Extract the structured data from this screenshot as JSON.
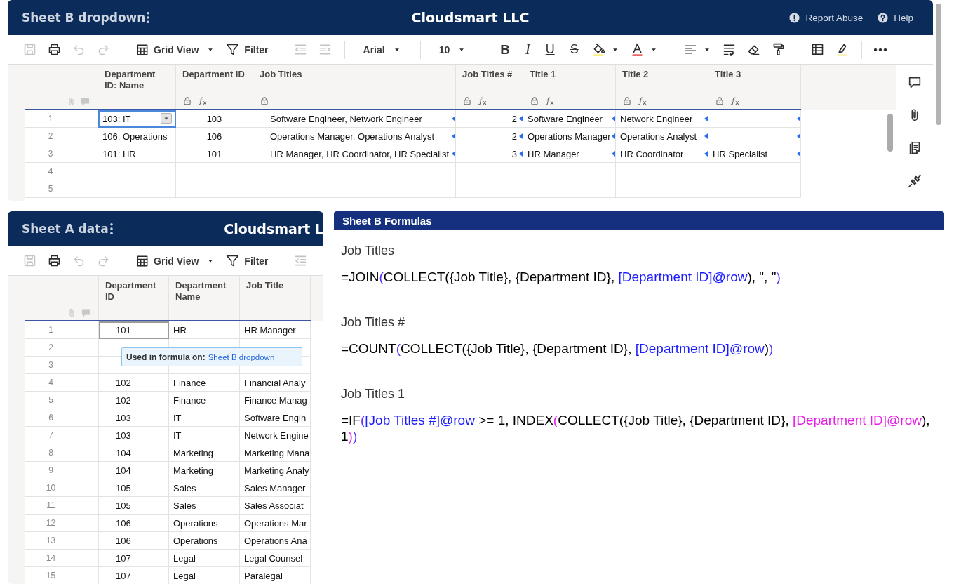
{
  "top_sheet": {
    "title": "Sheet B dropdown",
    "brand": "Cloudsmart LLC",
    "links": [
      {
        "kind": "report",
        "label": "Report Abuse"
      },
      {
        "kind": "help",
        "label": "Help"
      }
    ],
    "toolbar": [
      {
        "kind": "save",
        "disabled": true
      },
      {
        "kind": "print",
        "disabled": false
      },
      {
        "kind": "undo",
        "disabled": true
      },
      {
        "kind": "redo",
        "disabled": true
      },
      {
        "kind": "sep"
      },
      {
        "kind": "view",
        "label": "Grid View",
        "disabled": false
      },
      {
        "kind": "filter",
        "label": "Filter",
        "disabled": false
      },
      {
        "kind": "sep"
      },
      {
        "kind": "outdent",
        "disabled": true
      },
      {
        "kind": "indent",
        "disabled": true
      },
      {
        "kind": "sep"
      },
      {
        "kind": "font",
        "label": "Arial",
        "disabled": false
      },
      {
        "kind": "sep"
      },
      {
        "kind": "size",
        "label": "10",
        "disabled": false
      },
      {
        "kind": "sep"
      },
      {
        "kind": "bold",
        "label": "B",
        "disabled": false
      },
      {
        "kind": "italic",
        "label": "I",
        "disabled": false
      },
      {
        "kind": "underline",
        "label": "U",
        "disabled": false
      },
      {
        "kind": "strike",
        "label": "S",
        "disabled": false
      },
      {
        "kind": "fill",
        "disabled": false
      },
      {
        "kind": "textcolor",
        "disabled": false
      },
      {
        "kind": "sep"
      },
      {
        "kind": "align",
        "disabled": false
      },
      {
        "kind": "wrap",
        "disabled": false
      },
      {
        "kind": "eraser",
        "disabled": false
      },
      {
        "kind": "painter",
        "disabled": false
      },
      {
        "kind": "sep"
      },
      {
        "kind": "table",
        "disabled": false
      },
      {
        "kind": "highlight",
        "disabled": false
      },
      {
        "kind": "sep"
      },
      {
        "kind": "more",
        "disabled": false
      }
    ],
    "columns": [
      {
        "label": "Department ID: Name",
        "locked": false,
        "formula": false,
        "linked": false
      },
      {
        "label": "Department ID",
        "locked": true,
        "formula": true,
        "linked": false
      },
      {
        "label": "Job Titles",
        "locked": true,
        "formula": false,
        "linked": true
      },
      {
        "label": "Job Titles #",
        "locked": true,
        "formula": true,
        "linked": true
      },
      {
        "label": "Title 1",
        "locked": true,
        "formula": true,
        "linked": true
      },
      {
        "label": "Title 2",
        "locked": true,
        "formula": true,
        "linked": true
      },
      {
        "label": "Title 3",
        "locked": true,
        "formula": true,
        "linked": true
      }
    ],
    "rows": [
      {
        "number": "1",
        "cells": [
          {
            "text": "103: IT",
            "selected": true
          },
          {
            "text": "103",
            "selected": false
          },
          {
            "text": "Software Engineer, Network Engineer",
            "selected": false
          },
          {
            "text": "2",
            "selected": false
          },
          {
            "text": "Software Engineer",
            "selected": false
          },
          {
            "text": "Network Engineer",
            "selected": false
          },
          {
            "selected": false
          }
        ]
      },
      {
        "number": "2",
        "cells": [
          {
            "text": "106: Operations",
            "selected": false
          },
          {
            "text": "106",
            "selected": false
          },
          {
            "text": "Operations Manager, Operations Analyst",
            "selected": false
          },
          {
            "text": "2",
            "selected": false
          },
          {
            "text": "Operations Manager",
            "selected": false
          },
          {
            "text": "Operations Analyst",
            "selected": false
          },
          {
            "selected": false
          }
        ]
      },
      {
        "number": "3",
        "cells": [
          {
            "text": "101: HR",
            "selected": false
          },
          {
            "text": "101",
            "selected": false
          },
          {
            "text": "HR Manager, HR Coordinator, HR Specialist",
            "selected": false
          },
          {
            "text": "3",
            "selected": false
          },
          {
            "text": "HR Manager",
            "selected": false
          },
          {
            "text": "HR Coordinator",
            "selected": false
          },
          {
            "text": "HR Specialist",
            "selected": false
          }
        ]
      },
      {
        "number": "4",
        "cells": []
      },
      {
        "number": "5",
        "cells": []
      }
    ],
    "side_tools": [
      {
        "kind": "comments"
      },
      {
        "kind": "attachments"
      },
      {
        "kind": "summary"
      },
      {
        "kind": "connections"
      }
    ]
  },
  "bottom_sheet": {
    "title": "Sheet A data",
    "brand": "Cloudsmart L",
    "toolbar": [
      {
        "kind": "save",
        "disabled": true
      },
      {
        "kind": "print",
        "disabled": false
      },
      {
        "kind": "undo",
        "disabled": true
      },
      {
        "kind": "redo",
        "disabled": true
      },
      {
        "kind": "sep"
      },
      {
        "kind": "view",
        "label": "Grid View",
        "disabled": false
      },
      {
        "kind": "filter",
        "label": "Filter",
        "disabled": false
      },
      {
        "kind": "sep"
      },
      {
        "kind": "outdent",
        "disabled": true
      }
    ],
    "columns": [
      {
        "label": "Department ID"
      },
      {
        "label": "Department Name"
      },
      {
        "label": "Job Title"
      }
    ],
    "rows": [
      {
        "number": "1",
        "cells": [
          {
            "text": "101",
            "selected": true
          },
          {
            "text": "HR",
            "selected": false
          },
          {
            "text": "HR Manager",
            "selected": false
          }
        ]
      },
      {
        "number": "2",
        "cells": [
          {
            "selected": false
          },
          {
            "selected": false
          },
          {
            "selected": false
          }
        ]
      },
      {
        "number": "3",
        "cells": [
          {
            "selected": false
          },
          {
            "selected": false
          },
          {
            "selected": false
          }
        ]
      },
      {
        "number": "4",
        "cells": [
          {
            "text": "102",
            "selected": false
          },
          {
            "text": "Finance",
            "selected": false
          },
          {
            "text": "Financial Analy",
            "selected": false
          }
        ]
      },
      {
        "number": "5",
        "cells": [
          {
            "text": "102",
            "selected": false
          },
          {
            "text": "Finance",
            "selected": false
          },
          {
            "text": "Finance Manag",
            "selected": false
          }
        ]
      },
      {
        "number": "6",
        "cells": [
          {
            "text": "103",
            "selected": false
          },
          {
            "text": "IT",
            "selected": false
          },
          {
            "text": "Software Engin",
            "selected": false
          }
        ]
      },
      {
        "number": "7",
        "cells": [
          {
            "text": "103",
            "selected": false
          },
          {
            "text": "IT",
            "selected": false
          },
          {
            "text": "Network Engine",
            "selected": false
          }
        ]
      },
      {
        "number": "8",
        "cells": [
          {
            "text": "104",
            "selected": false
          },
          {
            "text": "Marketing",
            "selected": false
          },
          {
            "text": "Marketing Mana",
            "selected": false
          }
        ]
      },
      {
        "number": "9",
        "cells": [
          {
            "text": "104",
            "selected": false
          },
          {
            "text": "Marketing",
            "selected": false
          },
          {
            "text": "Marketing Analy",
            "selected": false
          }
        ]
      },
      {
        "number": "10",
        "cells": [
          {
            "text": "105",
            "selected": false
          },
          {
            "text": "Sales",
            "selected": false
          },
          {
            "text": "Sales Manager",
            "selected": false
          }
        ]
      },
      {
        "number": "11",
        "cells": [
          {
            "text": "105",
            "selected": false
          },
          {
            "text": "Sales",
            "selected": false
          },
          {
            "text": "Sales Associat",
            "selected": false
          }
        ]
      },
      {
        "number": "12",
        "cells": [
          {
            "text": "106",
            "selected": false
          },
          {
            "text": "Operations",
            "selected": false
          },
          {
            "text": "Operations Mar",
            "selected": false
          }
        ]
      },
      {
        "number": "13",
        "cells": [
          {
            "text": "106",
            "selected": false
          },
          {
            "text": "Operations",
            "selected": false
          },
          {
            "text": "Operations Ana",
            "selected": false
          }
        ]
      },
      {
        "number": "14",
        "cells": [
          {
            "text": "107",
            "selected": false
          },
          {
            "text": "Legal",
            "selected": false
          },
          {
            "text": "Legal Counsel",
            "selected": false
          }
        ]
      },
      {
        "number": "15",
        "cells": [
          {
            "text": "107",
            "selected": false
          },
          {
            "text": "Legal",
            "selected": false
          },
          {
            "text": "Paralegal",
            "selected": false
          }
        ]
      }
    ],
    "tooltip": {
      "label": "Used in formula on:",
      "link": "Sheet B dropdown"
    }
  },
  "formulas_panel": {
    "title": "Sheet B Formulas",
    "formulas": [
      {
        "heading": "Job Titles",
        "parts": [
          {
            "text": "=JOIN",
            "color": "#000000"
          },
          {
            "text": "(",
            "color": "#5a2dff"
          },
          {
            "text": "COLLECT({Job Title}, {Department ID}, ",
            "color": "#000000"
          },
          {
            "text": "[Department ID]@row",
            "color": "#1a1aff"
          },
          {
            "text": "), \", \"",
            "color": "#000000"
          },
          {
            "text": ")",
            "color": "#5a2dff"
          }
        ]
      },
      {
        "heading": "Job Titles #",
        "parts": [
          {
            "text": "=COUNT",
            "color": "#000000"
          },
          {
            "text": "(",
            "color": "#5a2dff"
          },
          {
            "text": "COLLECT({Job Title}, {Department ID}, ",
            "color": "#000000"
          },
          {
            "text": "[Department ID]@row",
            "color": "#1a1aff"
          },
          {
            "text": ")",
            "color": "#000000"
          },
          {
            "text": ")",
            "color": "#5a2dff"
          }
        ]
      },
      {
        "heading": "Job Titles 1",
        "parts": [
          {
            "text": "=IF",
            "color": "#000000"
          },
          {
            "text": "(",
            "color": "#5a2dff"
          },
          {
            "text": "[Job Titles #]@row",
            "color": "#1a1aff"
          },
          {
            "text": " >= 1, INDEX",
            "color": "#000000"
          },
          {
            "text": "(",
            "color": "#e81ce8"
          },
          {
            "text": "COLLECT({Job Title}, {Department ID}, ",
            "color": "#000000"
          },
          {
            "text": "[Department ID]@row",
            "color": "#e81ce8"
          },
          {
            "text": "), 1",
            "color": "#000000"
          },
          {
            "text": ")",
            "color": "#e81ce8"
          },
          {
            "text": ")",
            "color": "#5a2dff"
          }
        ]
      }
    ]
  }
}
